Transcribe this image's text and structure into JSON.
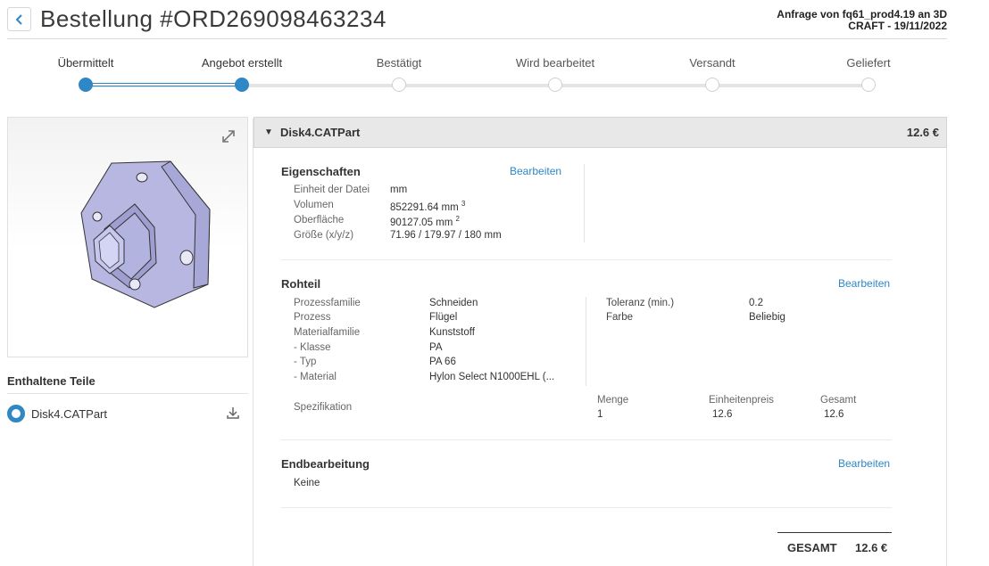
{
  "header": {
    "title": "Bestellung #ORD269098463234",
    "request_line1": "Anfrage von fq61_prod4.19 an 3D",
    "request_line2": "CRAFT - 19/11/2022"
  },
  "progress": {
    "steps": [
      {
        "label": "Übermittelt",
        "done": true
      },
      {
        "label": "Angebot erstellt",
        "done": true
      },
      {
        "label": "Bestätigt",
        "done": false
      },
      {
        "label": "Wird bearbeitet",
        "done": false
      },
      {
        "label": "Versandt",
        "done": false
      },
      {
        "label": "Geliefert",
        "done": false
      }
    ],
    "completed_fraction": 0.2,
    "accent": "#2f87c5"
  },
  "parts": {
    "heading": "Enthaltene Teile",
    "items": [
      {
        "name": "Disk4.CATPart"
      }
    ]
  },
  "panel": {
    "title": "Disk4.CATPart",
    "price": "12.6 €",
    "properties": {
      "heading": "Eigenschaften",
      "edit": "Bearbeiten",
      "rows": [
        {
          "label": "Einheit der Datei",
          "value": "mm"
        },
        {
          "label": "Volumen",
          "value": "852291.64 mm",
          "sup": "3"
        },
        {
          "label": "Oberfläche",
          "value": "90127.05 mm",
          "sup": "2"
        },
        {
          "label": "Größe (x/y/z)",
          "value": "71.96 / 179.97 / 180 mm"
        }
      ]
    },
    "raw": {
      "heading": "Rohteil",
      "edit": "Bearbeiten",
      "rows": [
        {
          "label": "Prozessfamilie",
          "value": "Schneiden"
        },
        {
          "label": "Prozess",
          "value": "Flügel"
        },
        {
          "label": "Materialfamilie",
          "value": "Kunststoff"
        },
        {
          "label": "- Klasse",
          "value": "PA"
        },
        {
          "label": "- Typ",
          "value": "PA 66"
        },
        {
          "label": "- Material",
          "value": "Hylon Select N1000EHL (..."
        }
      ],
      "right_rows": [
        {
          "label": "Toleranz (min.)",
          "value": "0.2"
        },
        {
          "label": "Farbe",
          "value": "Beliebig"
        }
      ],
      "spec_label": "Spezifikation",
      "qty_label": "Menge",
      "qty_value": "1",
      "unit_label": "Einheitenpreis",
      "unit_value": "12.6",
      "total_label": "Gesamt",
      "total_value": "12.6"
    },
    "finish": {
      "heading": "Endbearbeitung",
      "edit": "Bearbeiten",
      "value": "Keine"
    },
    "grand_total": {
      "label": "GESAMT",
      "value": "12.6 €"
    }
  }
}
